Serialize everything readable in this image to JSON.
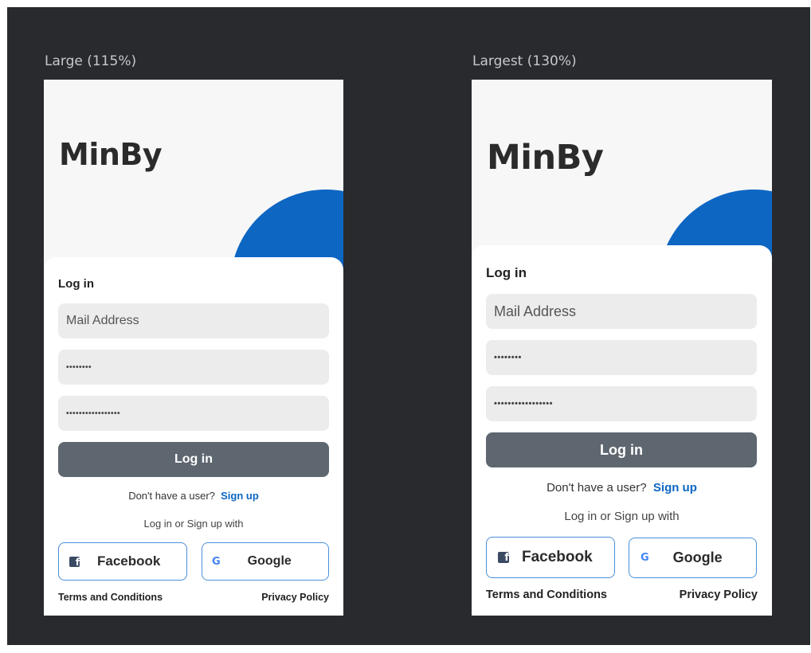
{
  "frames": [
    {
      "label": "Large (115%)",
      "brand": "MinBy",
      "card_title": "Log in",
      "email_placeholder": "Mail Address",
      "password_masked": "••••••••",
      "confirm_masked": "•••••••••••••••••",
      "login_button": "Log in",
      "no_user_text": "Don't have a user?",
      "signup_link": "Sign up",
      "social_text": "Log in or Sign up with",
      "facebook": "Facebook",
      "google": "Google",
      "terms": "Terms and Conditions",
      "privacy": "Privacy Policy"
    },
    {
      "label": "Largest (130%)",
      "brand": "MinBy",
      "card_title": "Log in",
      "email_placeholder": "Mail Address",
      "password_masked": "••••••••",
      "confirm_masked": "•••••••••••••••••",
      "login_button": "Log in",
      "no_user_text": "Don't have a user?",
      "signup_link": "Sign up",
      "social_text": "Log in or Sign up with",
      "facebook": "Facebook",
      "google": "Google",
      "terms": "Terms and Conditions",
      "privacy": "Privacy Policy"
    }
  ],
  "colors": {
    "canvas": "#292a2d",
    "brand_blue": "#0d66c2",
    "login_button": "#5e6670",
    "field_bg": "#ececed",
    "social_border": "#4a90d9"
  },
  "icons": [
    "facebook-icon",
    "google-icon"
  ]
}
